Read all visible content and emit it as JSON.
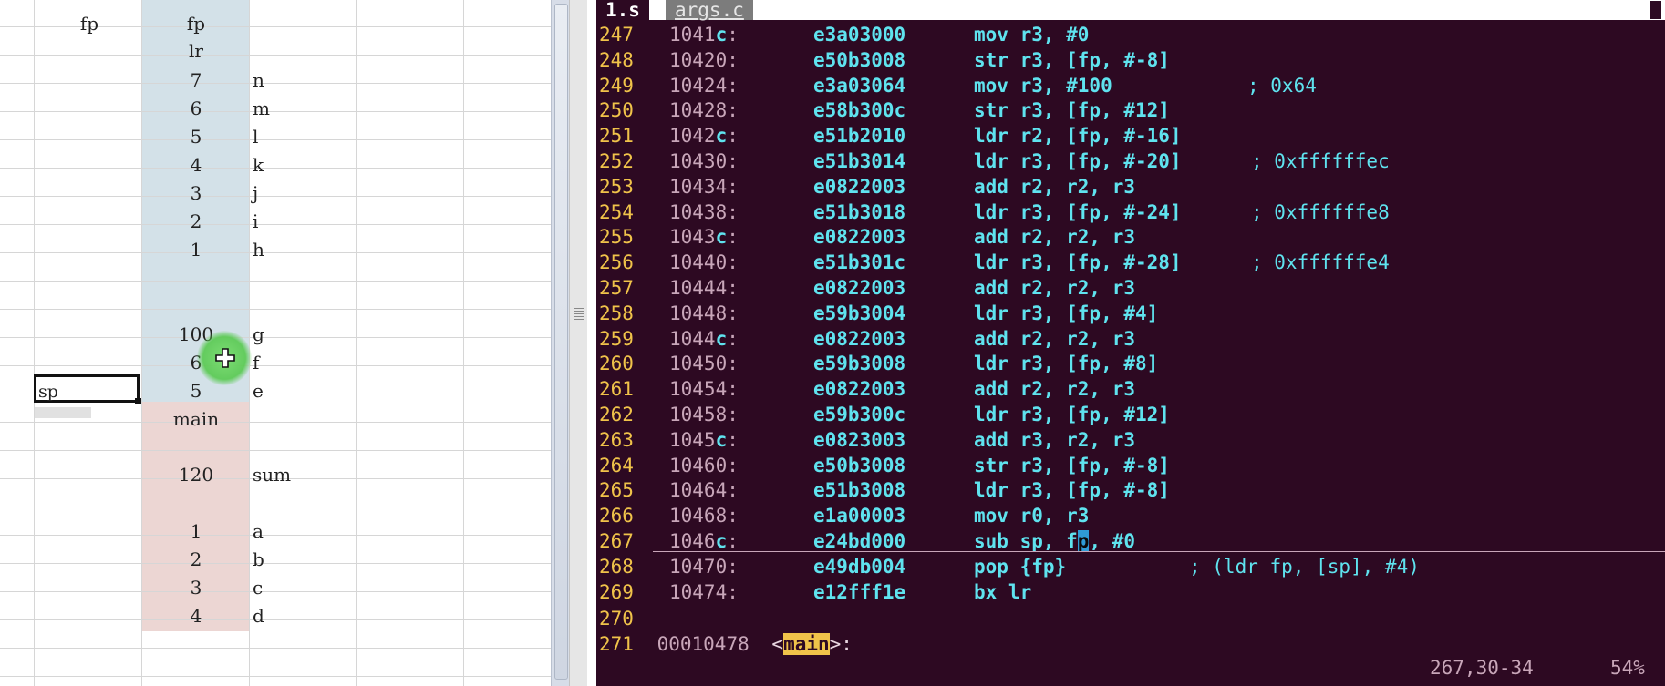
{
  "spreadsheet": {
    "fp_col_header": "fp",
    "sp_label": "sp",
    "stack_cells": [
      {
        "value": "fp",
        "label": "",
        "shade": "blue"
      },
      {
        "value": "lr",
        "label": "",
        "shade": "blue"
      },
      {
        "value": "7",
        "label": "n",
        "shade": "blue"
      },
      {
        "value": "6",
        "label": "m",
        "shade": "blue"
      },
      {
        "value": "5",
        "label": "l",
        "shade": "blue"
      },
      {
        "value": "4",
        "label": "k",
        "shade": "blue"
      },
      {
        "value": "3",
        "label": "j",
        "shade": "blue"
      },
      {
        "value": "2",
        "label": "i",
        "shade": "blue"
      },
      {
        "value": "1",
        "label": "h",
        "shade": "blue"
      },
      {
        "value": "100",
        "label": "g",
        "shade": "blue"
      },
      {
        "value": "6",
        "label": "f",
        "shade": "blue"
      },
      {
        "value": "5",
        "label": "e",
        "shade": "blue"
      },
      {
        "value": "main",
        "label": "",
        "shade": "pink"
      },
      {
        "value": "120",
        "label": "sum",
        "shade": "pink"
      },
      {
        "value": "1",
        "label": "a",
        "shade": "pink"
      },
      {
        "value": "2",
        "label": "b",
        "shade": "pink"
      },
      {
        "value": "3",
        "label": "c",
        "shade": "pink"
      },
      {
        "value": "4",
        "label": "d",
        "shade": "pink"
      }
    ],
    "colors": {
      "blue": "#d3e1e8",
      "pink": "#ecd6d3",
      "grid": "#d6d6d6"
    }
  },
  "editor": {
    "tabs": {
      "active": "1.s",
      "inactive": "args.c"
    },
    "lines": [
      {
        "num": "247",
        "addr": "1041",
        "addr_tail": "c",
        "sep": ":",
        "hex": "e3a03000",
        "asm": "mov r3, #0",
        "comment": ""
      },
      {
        "num": "248",
        "addr": "10420",
        "addr_tail": "",
        "sep": ":",
        "hex": "e50b3008",
        "asm": "str r3, [fp, #-8]",
        "comment": ""
      },
      {
        "num": "249",
        "addr": "10424",
        "addr_tail": "",
        "sep": ":",
        "hex": "e3a03064",
        "asm": "mov r3, #100",
        "comment": "; 0x64"
      },
      {
        "num": "250",
        "addr": "10428",
        "addr_tail": "",
        "sep": ":",
        "hex": "e58b300c",
        "asm": "str r3, [fp, #12]",
        "comment": ""
      },
      {
        "num": "251",
        "addr": "1042",
        "addr_tail": "c",
        "sep": ":",
        "hex": "e51b2010",
        "asm": "ldr r2, [fp, #-16]",
        "comment": ""
      },
      {
        "num": "252",
        "addr": "10430",
        "addr_tail": "",
        "sep": ":",
        "hex": "e51b3014",
        "asm": "ldr r3, [fp, #-20]",
        "comment": "; 0xffffffec"
      },
      {
        "num": "253",
        "addr": "10434",
        "addr_tail": "",
        "sep": ":",
        "hex": "e0822003",
        "asm": "add r2, r2, r3",
        "comment": ""
      },
      {
        "num": "254",
        "addr": "10438",
        "addr_tail": "",
        "sep": ":",
        "hex": "e51b3018",
        "asm": "ldr r3, [fp, #-24]",
        "comment": "; 0xffffffe8"
      },
      {
        "num": "255",
        "addr": "1043",
        "addr_tail": "c",
        "sep": ":",
        "hex": "e0822003",
        "asm": "add r2, r2, r3",
        "comment": ""
      },
      {
        "num": "256",
        "addr": "10440",
        "addr_tail": "",
        "sep": ":",
        "hex": "e51b301c",
        "asm": "ldr r3, [fp, #-28]",
        "comment": "; 0xffffffe4"
      },
      {
        "num": "257",
        "addr": "10444",
        "addr_tail": "",
        "sep": ":",
        "hex": "e0822003",
        "asm": "add r2, r2, r3",
        "comment": ""
      },
      {
        "num": "258",
        "addr": "10448",
        "addr_tail": "",
        "sep": ":",
        "hex": "e59b3004",
        "asm": "ldr r3, [fp, #4]",
        "comment": ""
      },
      {
        "num": "259",
        "addr": "1044",
        "addr_tail": "c",
        "sep": ":",
        "hex": "e0822003",
        "asm": "add r2, r2, r3",
        "comment": ""
      },
      {
        "num": "260",
        "addr": "10450",
        "addr_tail": "",
        "sep": ":",
        "hex": "e59b3008",
        "asm": "ldr r3, [fp, #8]",
        "comment": ""
      },
      {
        "num": "261",
        "addr": "10454",
        "addr_tail": "",
        "sep": ":",
        "hex": "e0822003",
        "asm": "add r2, r2, r3",
        "comment": ""
      },
      {
        "num": "262",
        "addr": "10458",
        "addr_tail": "",
        "sep": ":",
        "hex": "e59b300c",
        "asm": "ldr r3, [fp, #12]",
        "comment": ""
      },
      {
        "num": "263",
        "addr": "1045",
        "addr_tail": "c",
        "sep": ":",
        "hex": "e0823003",
        "asm": "add r3, r2, r3",
        "comment": ""
      },
      {
        "num": "264",
        "addr": "10460",
        "addr_tail": "",
        "sep": ":",
        "hex": "e50b3008",
        "asm": "str r3, [fp, #-8]",
        "comment": ""
      },
      {
        "num": "265",
        "addr": "10464",
        "addr_tail": "",
        "sep": ":",
        "hex": "e51b3008",
        "asm": "ldr r3, [fp, #-8]",
        "comment": ""
      },
      {
        "num": "266",
        "addr": "10468",
        "addr_tail": "",
        "sep": ":",
        "hex": "e1a00003",
        "asm": "mov r0, r3",
        "comment": ""
      },
      {
        "num": "267",
        "addr": "1046",
        "addr_tail": "c",
        "sep": ":",
        "hex": "e24bd000",
        "asm": "sub sp, fp, #0",
        "comment": ""
      },
      {
        "num": "268",
        "addr": "10470",
        "addr_tail": "",
        "sep": ":",
        "hex": "e49db004",
        "asm": "pop {fp}",
        "comment": "; (ldr fp, [sp], #4)"
      },
      {
        "num": "269",
        "addr": "10474",
        "addr_tail": "",
        "sep": ":",
        "hex": "e12fff1e",
        "asm": "bx lr",
        "comment": ""
      }
    ],
    "line_270": "270",
    "line_271": {
      "num": "271",
      "addr": "00010478",
      "open": "<",
      "symbol": "main",
      "close": ">:"
    },
    "cursor_line_parts": {
      "before": "sub sp, f",
      "cursor_char": "p",
      "after": ", #0"
    },
    "status": {
      "position": "267,30-34",
      "percent": "54%"
    },
    "colors": {
      "background": "#2d0922",
      "line_number": "#f0c34a",
      "code": "#5fe3ef",
      "dim": "#c8a6b9"
    }
  }
}
